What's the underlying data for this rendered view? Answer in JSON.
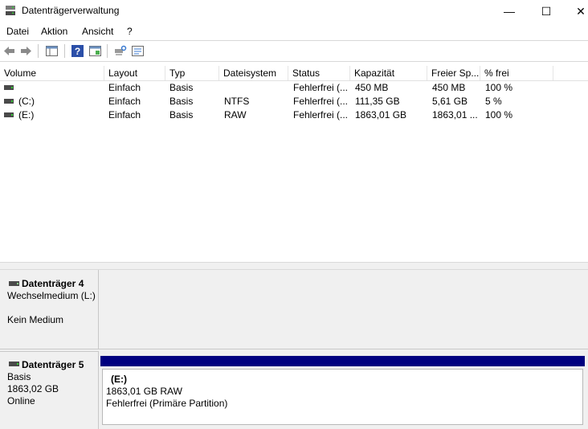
{
  "window": {
    "title": "Datenträgerverwaltung",
    "controls": {
      "minimize": "—",
      "maximize": "☐",
      "close": "✕"
    }
  },
  "menu": {
    "file": "Datei",
    "action": "Aktion",
    "view": "Ansicht",
    "help": "?"
  },
  "toolbar": {
    "icons": [
      "back-arrow-icon",
      "forward-arrow-icon",
      "console-tree-icon",
      "help-icon",
      "properties-icon",
      "connect-icon",
      "export-list-icon"
    ]
  },
  "volume_list": {
    "columns": [
      "Volume",
      "Layout",
      "Typ",
      "Dateisystem",
      "Status",
      "Kapazität",
      "Freier Sp...",
      "% frei"
    ],
    "rows": [
      {
        "volume": "",
        "layout": "Einfach",
        "type": "Basis",
        "fs": "",
        "status": "Fehlerfrei (...",
        "capacity": "450 MB",
        "free": "450 MB",
        "pct": "100 %"
      },
      {
        "volume": "(C:)",
        "layout": "Einfach",
        "type": "Basis",
        "fs": "NTFS",
        "status": "Fehlerfrei (...",
        "capacity": "111,35 GB",
        "free": "5,61 GB",
        "pct": "5 %"
      },
      {
        "volume": "(E:)",
        "layout": "Einfach",
        "type": "Basis",
        "fs": "RAW",
        "status": "Fehlerfrei (...",
        "capacity": "1863,01 GB",
        "free": "1863,01 ...",
        "pct": "100 %"
      }
    ]
  },
  "disks": {
    "disk4": {
      "title": "Datenträger 4",
      "kind": "Wechselmedium (L:)",
      "media": "Kein Medium"
    },
    "disk5": {
      "title": "Datenträger 5",
      "type": "Basis",
      "size": "1863,02 GB",
      "state": "Online",
      "partition": {
        "letter": "(E:)",
        "size_fs": "1863,01 GB RAW",
        "status": "Fehlerfrei (Primäre Partition)",
        "bar_color": "#00007f"
      }
    }
  }
}
